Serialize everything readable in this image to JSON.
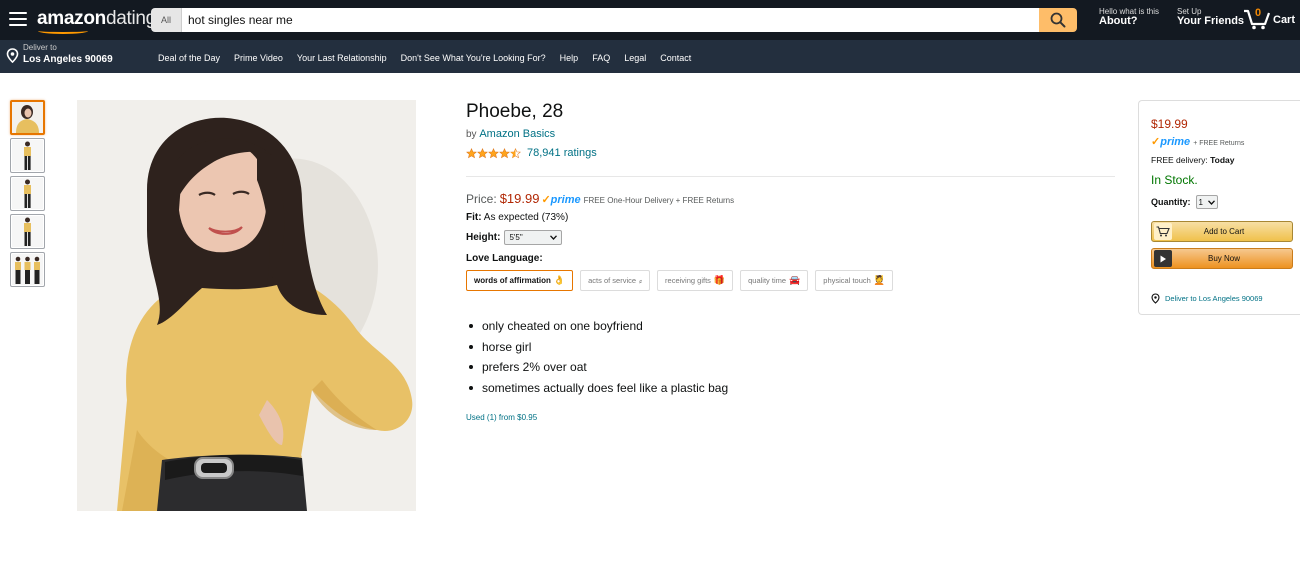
{
  "header": {
    "logo_bold": "amazon",
    "logo_light": "dating",
    "search_category": "All",
    "search_value": "hot singles near me",
    "account_top": "Hello what is this",
    "account_bottom": "About?",
    "signup_top": "Set Up",
    "signup_bottom": "Your Friends",
    "cart_count": "0",
    "cart_label": "Cart"
  },
  "subnav": {
    "deliver_top": "Deliver to",
    "deliver_bottom": "Los Angeles 90069",
    "links": [
      "Deal of the Day",
      "Prime Video",
      "Your Last Relationship",
      "Don't See What You're Looking For?",
      "Help",
      "FAQ",
      "Legal",
      "Contact"
    ]
  },
  "product": {
    "title": "Phoebe, 28",
    "by_prefix": "by",
    "brand": "Amazon Basics",
    "rating_stars": 4.5,
    "ratings_text": "78,941 ratings",
    "price_label": "Price:",
    "price": "$19.99",
    "prime_label": "prime",
    "shipping_text": "FREE One-Hour Delivery + FREE Returns",
    "fit_label": "Fit:",
    "fit_value": "As expected (73%)",
    "height_label": "Height:",
    "height_value": "5'5\"",
    "love_label": "Love Language:",
    "love_options": [
      {
        "label": "words of affirmation",
        "emoji": "👌",
        "selected": true
      },
      {
        "label": "acts of service",
        "emoji": "⸗",
        "selected": false
      },
      {
        "label": "receiving gifts",
        "emoji": "🎁",
        "selected": false
      },
      {
        "label": "quality time",
        "emoji": "🚘",
        "selected": false
      },
      {
        "label": "physical touch",
        "emoji": "💆",
        "selected": false
      }
    ],
    "bullets": [
      "only cheated on one boyfriend",
      "horse girl",
      "prefers 2% over oat",
      "sometimes actually does feel like a plastic bag"
    ],
    "used_text": "Used (1) from $0.95"
  },
  "buybox": {
    "price": "$19.99",
    "prime_label": "prime",
    "returns": "+ FREE Returns",
    "free_delivery_prefix": "FREE delivery:",
    "free_delivery_day": "Today",
    "stock": "In Stock.",
    "quantity_label": "Quantity:",
    "quantity_value": "1",
    "add_to_cart": "Add to Cart",
    "buy_now": "Buy Now",
    "deliver_text": "Deliver to Los Angeles 90069"
  },
  "colors": {
    "nav_dark": "#131921",
    "nav_sub": "#232f3e",
    "accent_orange": "#ff9900",
    "price_red": "#b12704",
    "link_teal": "#007185",
    "stock_green": "#007600",
    "sweater_yellow": "#e7bf5f"
  }
}
